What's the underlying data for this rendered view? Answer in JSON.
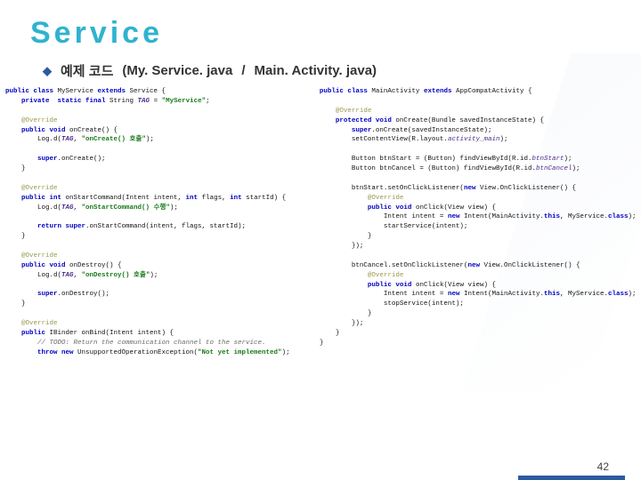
{
  "title": "Service",
  "subtitle": {
    "label": "예제 코드",
    "file1": "(My. Service. java",
    "sep": "/",
    "file2": "Main. Activity. java)"
  },
  "left_code": {
    "l1a": "public class",
    "l1b": " MyService ",
    "l1c": "extends",
    "l1d": " Service {",
    "l2a": "    private  static final",
    "l2b": " String ",
    "l2c": "TAG",
    "l2d": " = ",
    "l2e": "\"MyService\"",
    "l2f": ";",
    "l3": " ",
    "l4": "    @Override",
    "l5a": "    public void",
    "l5b": " onCreate() {",
    "l6a": "        Log.d(",
    "l6b": "TAG",
    "l6c": ", ",
    "l6d": "\"onCreate() 호출\"",
    "l6e": ");",
    "l7": " ",
    "l8a": "        super",
    "l8b": ".onCreate();",
    "l9": "    }",
    "l10": " ",
    "l11": "    @Override",
    "l12a": "    public int",
    "l12b": " onStartCommand(Intent intent, ",
    "l12c": "int",
    "l12d": " flags, ",
    "l12e": "int",
    "l12f": " startId) {",
    "l13a": "        Log.d(",
    "l13b": "TAG",
    "l13c": ", ",
    "l13d": "\"onStartCommand() 수행\"",
    "l13e": ");",
    "l14": " ",
    "l15a": "        return super",
    "l15b": ".onStartCommand(intent, flags, startId);",
    "l16": "    }",
    "l17": " ",
    "l18": "    @Override",
    "l19a": "    public void",
    "l19b": " onDestroy() {",
    "l20a": "        Log.d(",
    "l20b": "TAG",
    "l20c": ", ",
    "l20d": "\"onDestroy() 호출\"",
    "l20e": ");",
    "l21": " ",
    "l22a": "        super",
    "l22b": ".onDestroy();",
    "l23": "    }",
    "l24": " ",
    "l25": "    @Override",
    "l26a": "    public",
    "l26b": " IBinder onBind(Intent intent) {",
    "l27": "        // TODO: Return the communication channel to the service.",
    "l28a": "        throw new",
    "l28b": " UnsupportedOperationException(",
    "l28c": "\"Not yet implemented\"",
    "l28d": ");"
  },
  "right_code": {
    "r1a": "public class",
    "r1b": " MainActivity ",
    "r1c": "extends",
    "r1d": " AppCompatActivity {",
    "r2": " ",
    "r3": "    @Override",
    "r4a": "    protected void",
    "r4b": " onCreate(Bundle savedInstanceState) {",
    "r5a": "        super",
    "r5b": ".onCreate(savedInstanceState);",
    "r6a": "        setContentView(R.layout.",
    "r6b": "activity_main",
    "r6c": ");",
    "r7": " ",
    "r8a": "        Button btnStart = (Button) findViewById(R.id.",
    "r8b": "btnStart",
    "r8c": ");",
    "r9a": "        Button btnCancel = (Button) findViewById(R.id.",
    "r9b": "btnCancel",
    "r9c": ");",
    "r10": " ",
    "r11a": "        btnStart.setOnClickListener(",
    "r11b": "new",
    "r11c": " View.OnClickListener() {",
    "r12": "            @Override",
    "r13a": "            public void",
    "r13b": " onClick(View view) {",
    "r14a": "                Intent intent = ",
    "r14b": "new",
    "r14c": " Intent(MainActivity.",
    "r14d": "this",
    "r14e": ", MyService.",
    "r14f": "class",
    "r14g": ");",
    "r15": "                startService(intent);",
    "r16": "            }",
    "r17": "        });",
    "r18": " ",
    "r19a": "        btnCancel.setOnClickListener(",
    "r19b": "new",
    "r19c": " View.OnClickListener() {",
    "r20": "            @Override",
    "r21a": "            public void",
    "r21b": " onClick(View view) {",
    "r22a": "                Intent intent = ",
    "r22b": "new",
    "r22c": " Intent(MainActivity.",
    "r22d": "this",
    "r22e": ", MyService.",
    "r22f": "class",
    "r22g": ");",
    "r23": "                stopService(intent);",
    "r24": "            }",
    "r25": "        });",
    "r26": "    }",
    "r27": "}"
  },
  "page_number": "42"
}
